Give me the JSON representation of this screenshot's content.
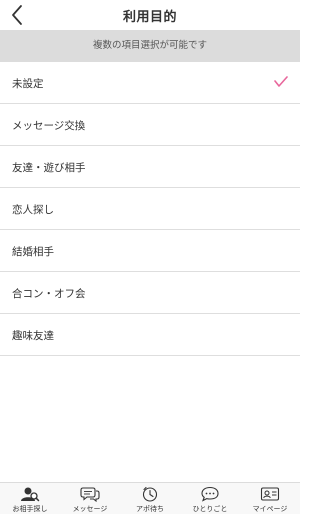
{
  "header": {
    "title": "利用目的",
    "back_icon": "chevron-left-icon"
  },
  "notice": {
    "text": "複数の項目選択が可能です"
  },
  "options": [
    {
      "label": "未設定",
      "selected": true
    },
    {
      "label": "メッセージ交換",
      "selected": false
    },
    {
      "label": "友達・遊び相手",
      "selected": false
    },
    {
      "label": "恋人探し",
      "selected": false
    },
    {
      "label": "結婚相手",
      "selected": false
    },
    {
      "label": "合コン・オフ会",
      "selected": false
    },
    {
      "label": "趣味友達",
      "selected": false
    }
  ],
  "check": {
    "icon": "checkmark-icon",
    "color": "#e8679c"
  },
  "tabbar": {
    "tabs": [
      {
        "label": "お相手探し",
        "icon": "search-person-icon",
        "active": true
      },
      {
        "label": "メッセージ",
        "icon": "chat-bubbles-icon",
        "active": false
      },
      {
        "label": "アポ待ち",
        "icon": "clock-icon",
        "active": false
      },
      {
        "label": "ひとりごと",
        "icon": "speech-bubble-icon",
        "active": false
      },
      {
        "label": "マイページ",
        "icon": "id-card-icon",
        "active": false
      }
    ]
  },
  "colors": {
    "notice_bg": "#dcdcdc",
    "divider": "#dedede",
    "accent": "#e8679c"
  }
}
